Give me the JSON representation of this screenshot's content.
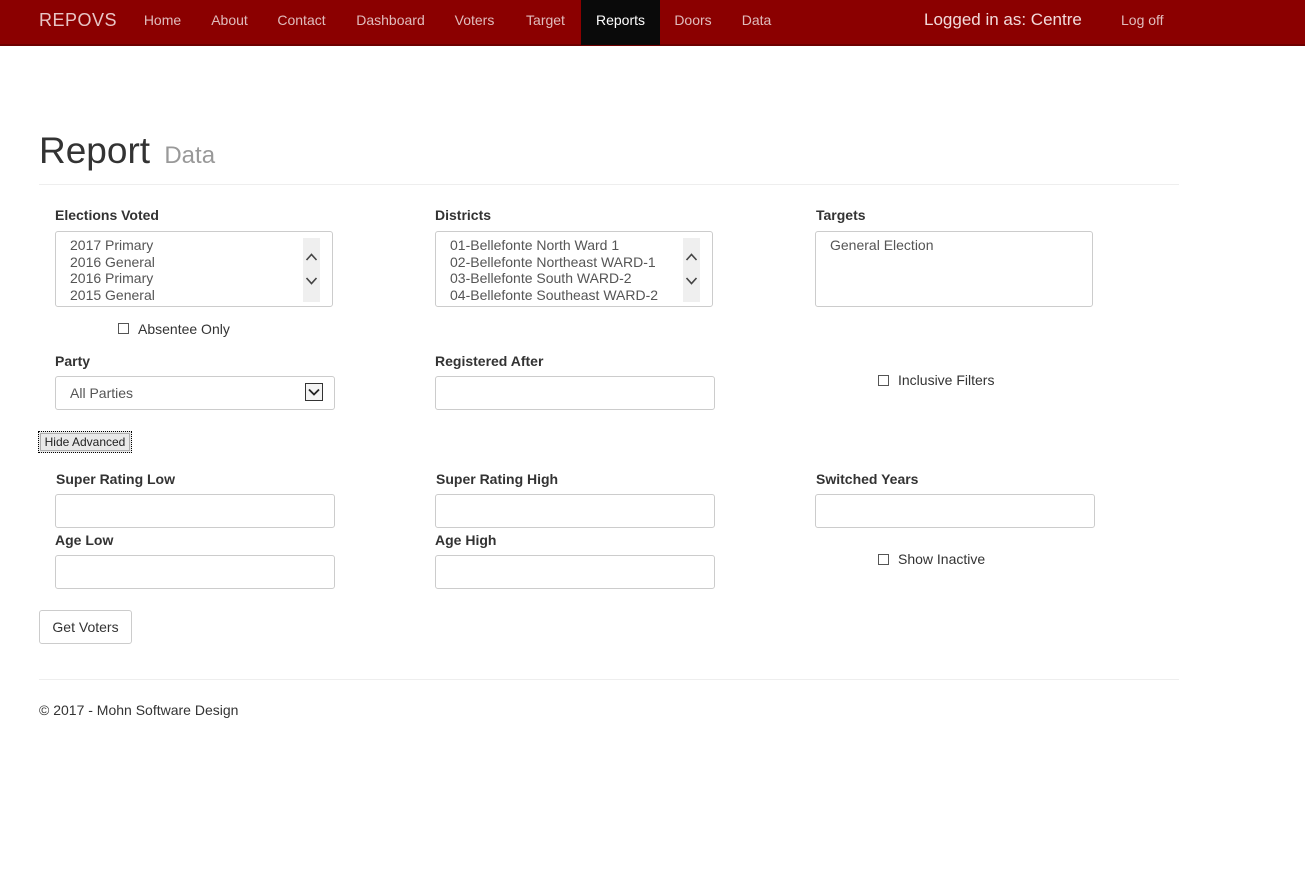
{
  "nav": {
    "brand": "REPOVS",
    "items": [
      "Home",
      "About",
      "Contact",
      "Dashboard",
      "Voters",
      "Target",
      "Reports",
      "Doors",
      "Data"
    ],
    "active": "Reports",
    "logged_in": "Logged in as: Centre",
    "logoff": "Log off",
    "colors": {
      "bar": "#8b0000",
      "active": "#0a0a0a"
    }
  },
  "header": {
    "title": "Report",
    "subtitle": "Data"
  },
  "filters": {
    "elections_label": "Elections Voted",
    "elections_options": [
      "2017 Primary",
      "2016 General",
      "2016 Primary",
      "2015 General"
    ],
    "absentee_label": "Absentee Only",
    "districts_label": "Districts",
    "districts_options": [
      "01-Bellefonte North Ward 1",
      "02-Bellefonte Northeast WARD-1",
      "03-Bellefonte South WARD-2",
      "04-Bellefonte Southeast WARD-2"
    ],
    "targets_label": "Targets",
    "targets_options": [
      "General Election"
    ],
    "party_label": "Party",
    "party_value": "All Parties",
    "registered_label": "Registered After",
    "registered_value": "",
    "inclusive_label": "Inclusive Filters"
  },
  "advanced": {
    "toggle_label": "Hide Advanced",
    "super_low_label": "Super Rating Low",
    "super_high_label": "Super Rating High",
    "switched_label": "Switched Years",
    "age_low_label": "Age Low",
    "age_high_label": "Age High",
    "inactive_label": "Show Inactive"
  },
  "actions": {
    "get_voters": "Get Voters"
  },
  "footer": {
    "text": "© 2017 - Mohn Software Design"
  }
}
